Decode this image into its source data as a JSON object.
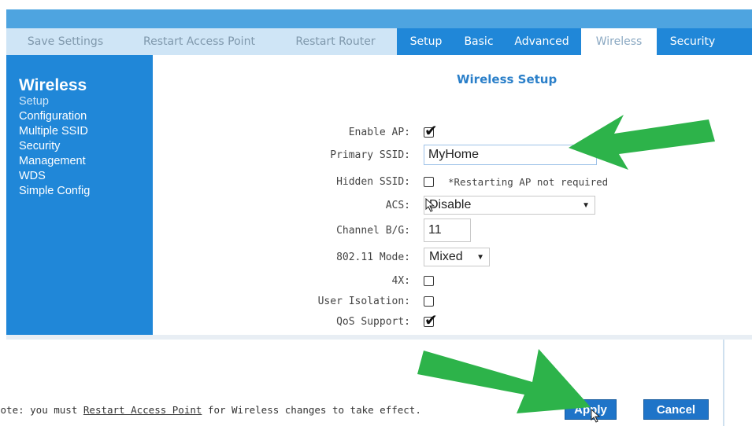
{
  "nav": {
    "tabs": [
      {
        "label": "Save Settings",
        "group": "light"
      },
      {
        "label": "Restart Access Point",
        "group": "light"
      },
      {
        "label": "Restart Router",
        "group": "light"
      },
      {
        "label": "Setup",
        "group": "dark"
      },
      {
        "label": "Basic",
        "group": "dark"
      },
      {
        "label": "Advanced",
        "group": "dark"
      },
      {
        "label": "Wireless",
        "group": "dark",
        "active": true
      },
      {
        "label": "Security",
        "group": "dark"
      }
    ]
  },
  "sidebar": {
    "heading": "Wireless",
    "items": [
      {
        "label": "Setup",
        "current": true
      },
      {
        "label": "Configuration"
      },
      {
        "label": "Multiple SSID"
      },
      {
        "label": "Security"
      },
      {
        "label": "Management"
      },
      {
        "label": "WDS"
      },
      {
        "label": "Simple Config"
      }
    ]
  },
  "main": {
    "title": "Wireless Setup",
    "fields": {
      "enable_ap": {
        "label": "Enable AP:",
        "checked": true
      },
      "primary_ssid": {
        "label": "Primary SSID:",
        "value": "MyHome"
      },
      "hidden_ssid": {
        "label": "Hidden SSID:",
        "checked": false,
        "note": "*Restarting AP not required"
      },
      "acs": {
        "label": "ACS:",
        "value": "Disable"
      },
      "channel": {
        "label": "Channel B/G:",
        "value": "11"
      },
      "mode": {
        "label": "802.11 Mode:",
        "value": "Mixed"
      },
      "fourx": {
        "label": "4X:",
        "checked": false
      },
      "user_isolation": {
        "label": "User Isolation:",
        "checked": false
      },
      "qos": {
        "label": "QoS Support:",
        "checked": true
      }
    }
  },
  "footer": {
    "note_prefix": "Note: you must ",
    "note_link": "Restart Access Point",
    "note_suffix": " for Wireless changes to take effect.",
    "apply_label": "Apply",
    "cancel_label": "Cancel"
  },
  "colors": {
    "nav_dark": "#2087d8",
    "nav_light": "#cfe5f6",
    "button": "#1f74c8",
    "annotation_arrow": "#2db34a"
  },
  "icons": {
    "check": "check-mark-icon",
    "caret": "dropdown-caret-icon",
    "cursor": "mouse-cursor-icon",
    "arrow": "annotation-arrow-icon"
  }
}
